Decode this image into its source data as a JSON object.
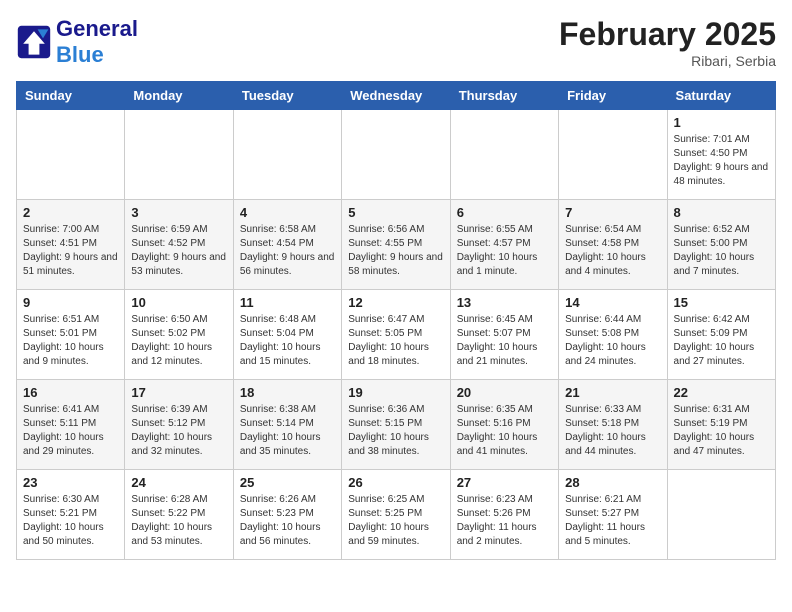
{
  "header": {
    "logo_general": "General",
    "logo_blue": "Blue",
    "month_year": "February 2025",
    "location": "Ribari, Serbia"
  },
  "days_of_week": [
    "Sunday",
    "Monday",
    "Tuesday",
    "Wednesday",
    "Thursday",
    "Friday",
    "Saturday"
  ],
  "weeks": [
    [
      {
        "day": "",
        "info": ""
      },
      {
        "day": "",
        "info": ""
      },
      {
        "day": "",
        "info": ""
      },
      {
        "day": "",
        "info": ""
      },
      {
        "day": "",
        "info": ""
      },
      {
        "day": "",
        "info": ""
      },
      {
        "day": "1",
        "info": "Sunrise: 7:01 AM\nSunset: 4:50 PM\nDaylight: 9 hours and 48 minutes."
      }
    ],
    [
      {
        "day": "2",
        "info": "Sunrise: 7:00 AM\nSunset: 4:51 PM\nDaylight: 9 hours and 51 minutes."
      },
      {
        "day": "3",
        "info": "Sunrise: 6:59 AM\nSunset: 4:52 PM\nDaylight: 9 hours and 53 minutes."
      },
      {
        "day": "4",
        "info": "Sunrise: 6:58 AM\nSunset: 4:54 PM\nDaylight: 9 hours and 56 minutes."
      },
      {
        "day": "5",
        "info": "Sunrise: 6:56 AM\nSunset: 4:55 PM\nDaylight: 9 hours and 58 minutes."
      },
      {
        "day": "6",
        "info": "Sunrise: 6:55 AM\nSunset: 4:57 PM\nDaylight: 10 hours and 1 minute."
      },
      {
        "day": "7",
        "info": "Sunrise: 6:54 AM\nSunset: 4:58 PM\nDaylight: 10 hours and 4 minutes."
      },
      {
        "day": "8",
        "info": "Sunrise: 6:52 AM\nSunset: 5:00 PM\nDaylight: 10 hours and 7 minutes."
      }
    ],
    [
      {
        "day": "9",
        "info": "Sunrise: 6:51 AM\nSunset: 5:01 PM\nDaylight: 10 hours and 9 minutes."
      },
      {
        "day": "10",
        "info": "Sunrise: 6:50 AM\nSunset: 5:02 PM\nDaylight: 10 hours and 12 minutes."
      },
      {
        "day": "11",
        "info": "Sunrise: 6:48 AM\nSunset: 5:04 PM\nDaylight: 10 hours and 15 minutes."
      },
      {
        "day": "12",
        "info": "Sunrise: 6:47 AM\nSunset: 5:05 PM\nDaylight: 10 hours and 18 minutes."
      },
      {
        "day": "13",
        "info": "Sunrise: 6:45 AM\nSunset: 5:07 PM\nDaylight: 10 hours and 21 minutes."
      },
      {
        "day": "14",
        "info": "Sunrise: 6:44 AM\nSunset: 5:08 PM\nDaylight: 10 hours and 24 minutes."
      },
      {
        "day": "15",
        "info": "Sunrise: 6:42 AM\nSunset: 5:09 PM\nDaylight: 10 hours and 27 minutes."
      }
    ],
    [
      {
        "day": "16",
        "info": "Sunrise: 6:41 AM\nSunset: 5:11 PM\nDaylight: 10 hours and 29 minutes."
      },
      {
        "day": "17",
        "info": "Sunrise: 6:39 AM\nSunset: 5:12 PM\nDaylight: 10 hours and 32 minutes."
      },
      {
        "day": "18",
        "info": "Sunrise: 6:38 AM\nSunset: 5:14 PM\nDaylight: 10 hours and 35 minutes."
      },
      {
        "day": "19",
        "info": "Sunrise: 6:36 AM\nSunset: 5:15 PM\nDaylight: 10 hours and 38 minutes."
      },
      {
        "day": "20",
        "info": "Sunrise: 6:35 AM\nSunset: 5:16 PM\nDaylight: 10 hours and 41 minutes."
      },
      {
        "day": "21",
        "info": "Sunrise: 6:33 AM\nSunset: 5:18 PM\nDaylight: 10 hours and 44 minutes."
      },
      {
        "day": "22",
        "info": "Sunrise: 6:31 AM\nSunset: 5:19 PM\nDaylight: 10 hours and 47 minutes."
      }
    ],
    [
      {
        "day": "23",
        "info": "Sunrise: 6:30 AM\nSunset: 5:21 PM\nDaylight: 10 hours and 50 minutes."
      },
      {
        "day": "24",
        "info": "Sunrise: 6:28 AM\nSunset: 5:22 PM\nDaylight: 10 hours and 53 minutes."
      },
      {
        "day": "25",
        "info": "Sunrise: 6:26 AM\nSunset: 5:23 PM\nDaylight: 10 hours and 56 minutes."
      },
      {
        "day": "26",
        "info": "Sunrise: 6:25 AM\nSunset: 5:25 PM\nDaylight: 10 hours and 59 minutes."
      },
      {
        "day": "27",
        "info": "Sunrise: 6:23 AM\nSunset: 5:26 PM\nDaylight: 11 hours and 2 minutes."
      },
      {
        "day": "28",
        "info": "Sunrise: 6:21 AM\nSunset: 5:27 PM\nDaylight: 11 hours and 5 minutes."
      },
      {
        "day": "",
        "info": ""
      }
    ]
  ]
}
